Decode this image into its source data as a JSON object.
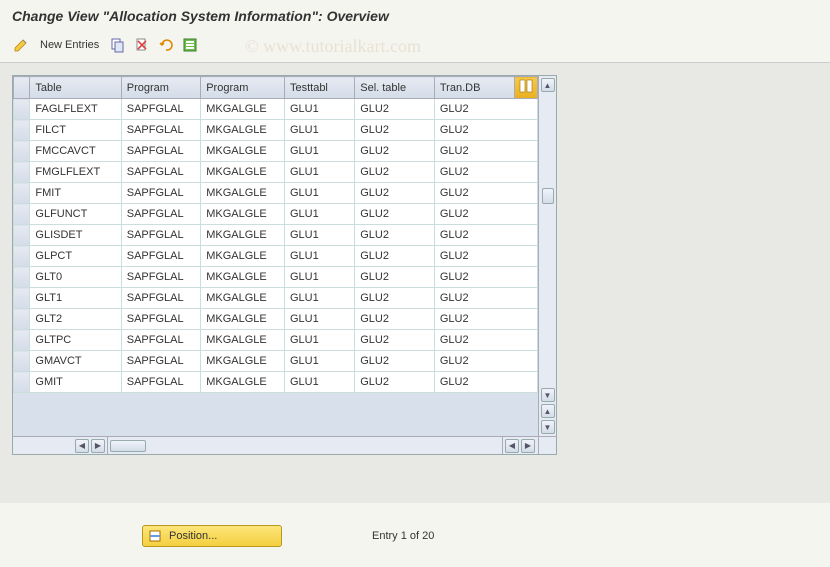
{
  "title": "Change View \"Allocation System Information\": Overview",
  "watermark": "© www.tutorialkart.com",
  "toolbar": {
    "new_entries_label": "New Entries"
  },
  "table": {
    "headers": {
      "table": "Table",
      "program1": "Program",
      "program2": "Program",
      "testtabl": "Testtabl",
      "sel_table": "Sel. table",
      "tran_db": "Tran.DB"
    },
    "rows": [
      {
        "table": "FAGLFLEXT",
        "program1": "SAPFGLAL",
        "program2": "MKGALGLE",
        "testtabl": "GLU1",
        "sel_table": "GLU2",
        "tran_db": "GLU2"
      },
      {
        "table": "FILCT",
        "program1": "SAPFGLAL",
        "program2": "MKGALGLE",
        "testtabl": "GLU1",
        "sel_table": "GLU2",
        "tran_db": "GLU2"
      },
      {
        "table": "FMCCAVCT",
        "program1": "SAPFGLAL",
        "program2": "MKGALGLE",
        "testtabl": "GLU1",
        "sel_table": "GLU2",
        "tran_db": "GLU2"
      },
      {
        "table": "FMGLFLEXT",
        "program1": "SAPFGLAL",
        "program2": "MKGALGLE",
        "testtabl": "GLU1",
        "sel_table": "GLU2",
        "tran_db": "GLU2"
      },
      {
        "table": "FMIT",
        "program1": "SAPFGLAL",
        "program2": "MKGALGLE",
        "testtabl": "GLU1",
        "sel_table": "GLU2",
        "tran_db": "GLU2"
      },
      {
        "table": "GLFUNCT",
        "program1": "SAPFGLAL",
        "program2": "MKGALGLE",
        "testtabl": "GLU1",
        "sel_table": "GLU2",
        "tran_db": "GLU2"
      },
      {
        "table": "GLISDET",
        "program1": "SAPFGLAL",
        "program2": "MKGALGLE",
        "testtabl": "GLU1",
        "sel_table": "GLU2",
        "tran_db": "GLU2"
      },
      {
        "table": "GLPCT",
        "program1": "SAPFGLAL",
        "program2": "MKGALGLE",
        "testtabl": "GLU1",
        "sel_table": "GLU2",
        "tran_db": "GLU2"
      },
      {
        "table": "GLT0",
        "program1": "SAPFGLAL",
        "program2": "MKGALGLE",
        "testtabl": "GLU1",
        "sel_table": "GLU2",
        "tran_db": "GLU2"
      },
      {
        "table": "GLT1",
        "program1": "SAPFGLAL",
        "program2": "MKGALGLE",
        "testtabl": "GLU1",
        "sel_table": "GLU2",
        "tran_db": "GLU2"
      },
      {
        "table": "GLT2",
        "program1": "SAPFGLAL",
        "program2": "MKGALGLE",
        "testtabl": "GLU1",
        "sel_table": "GLU2",
        "tran_db": "GLU2"
      },
      {
        "table": "GLTPC",
        "program1": "SAPFGLAL",
        "program2": "MKGALGLE",
        "testtabl": "GLU1",
        "sel_table": "GLU2",
        "tran_db": "GLU2"
      },
      {
        "table": "GMAVCT",
        "program1": "SAPFGLAL",
        "program2": "MKGALGLE",
        "testtabl": "GLU1",
        "sel_table": "GLU2",
        "tran_db": "GLU2"
      },
      {
        "table": "GMIT",
        "program1": "SAPFGLAL",
        "program2": "MKGALGLE",
        "testtabl": "GLU1",
        "sel_table": "GLU2",
        "tran_db": "GLU2"
      }
    ]
  },
  "footer": {
    "position_label": "Position...",
    "entry_text": "Entry 1 of 20"
  }
}
